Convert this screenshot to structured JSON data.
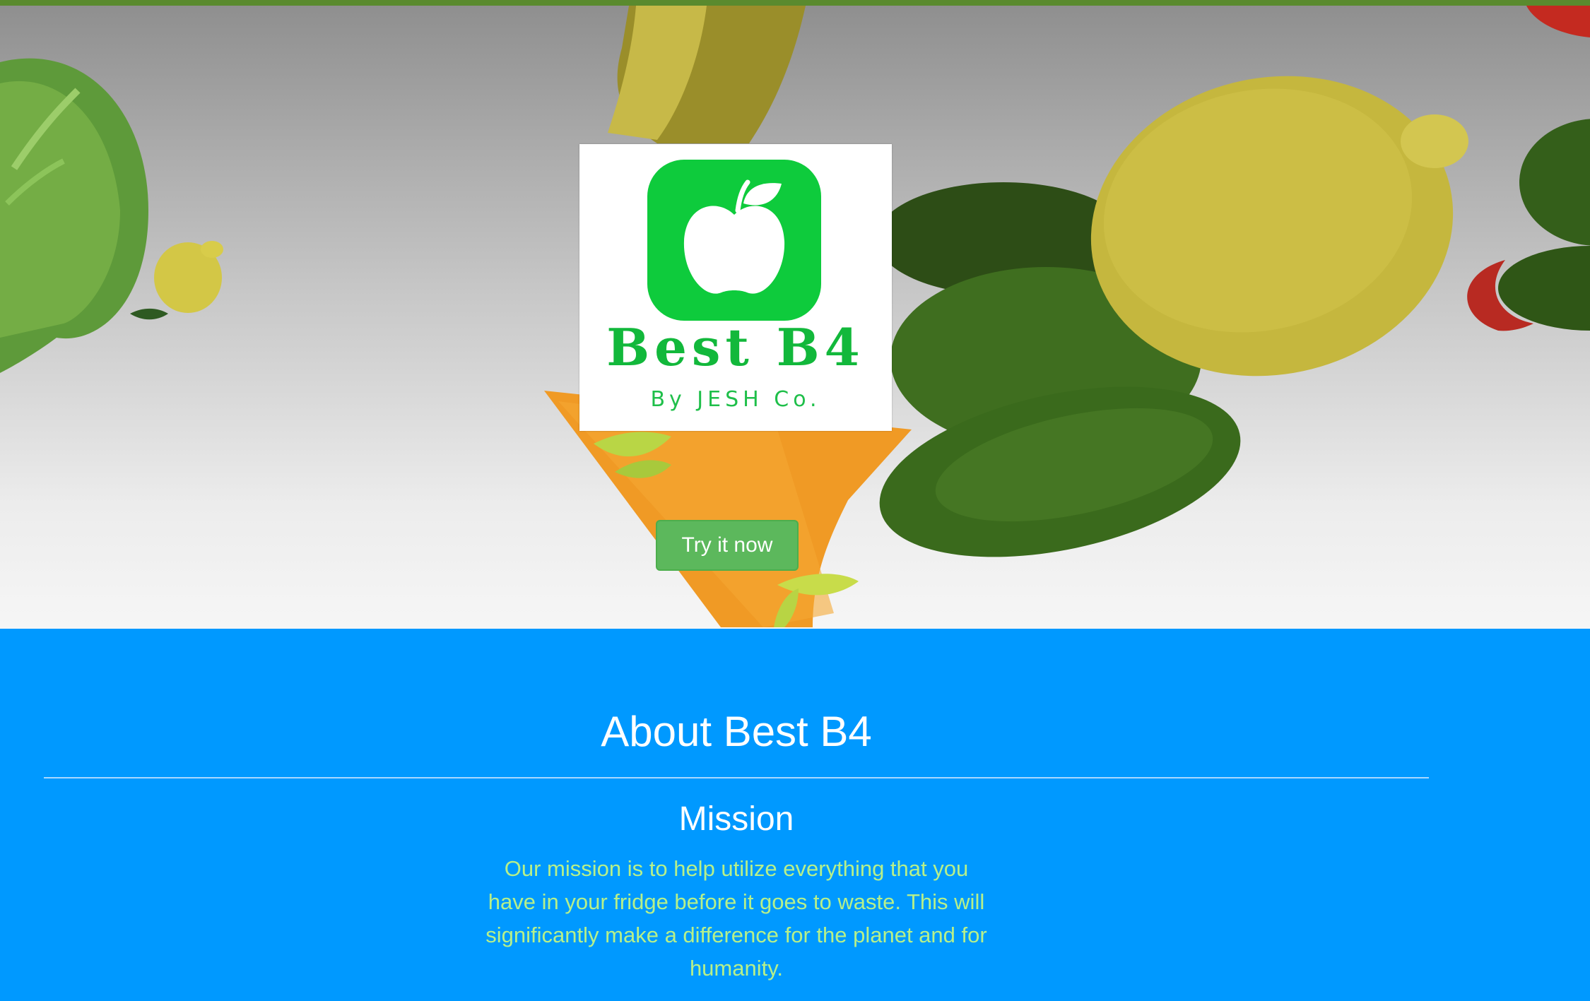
{
  "hero": {
    "brand_name": "Best B4",
    "brand_tagline": "By JESH Co.",
    "cta_label": "Try it now"
  },
  "about": {
    "title": "About Best B4",
    "mission_heading": "Mission",
    "mission_text": "Our mission is to help utilize everything that you have in your fridge before it goes to waste. This will significantly make a difference for the planet and for humanity."
  },
  "colors": {
    "top_strip": "#5a8a2e",
    "brand_green": "#0ecb3c",
    "button_green": "#5cb85c",
    "about_background": "#0099ff",
    "mission_text": "#b6f08a"
  },
  "icons": [
    "apple-logo-icon"
  ]
}
